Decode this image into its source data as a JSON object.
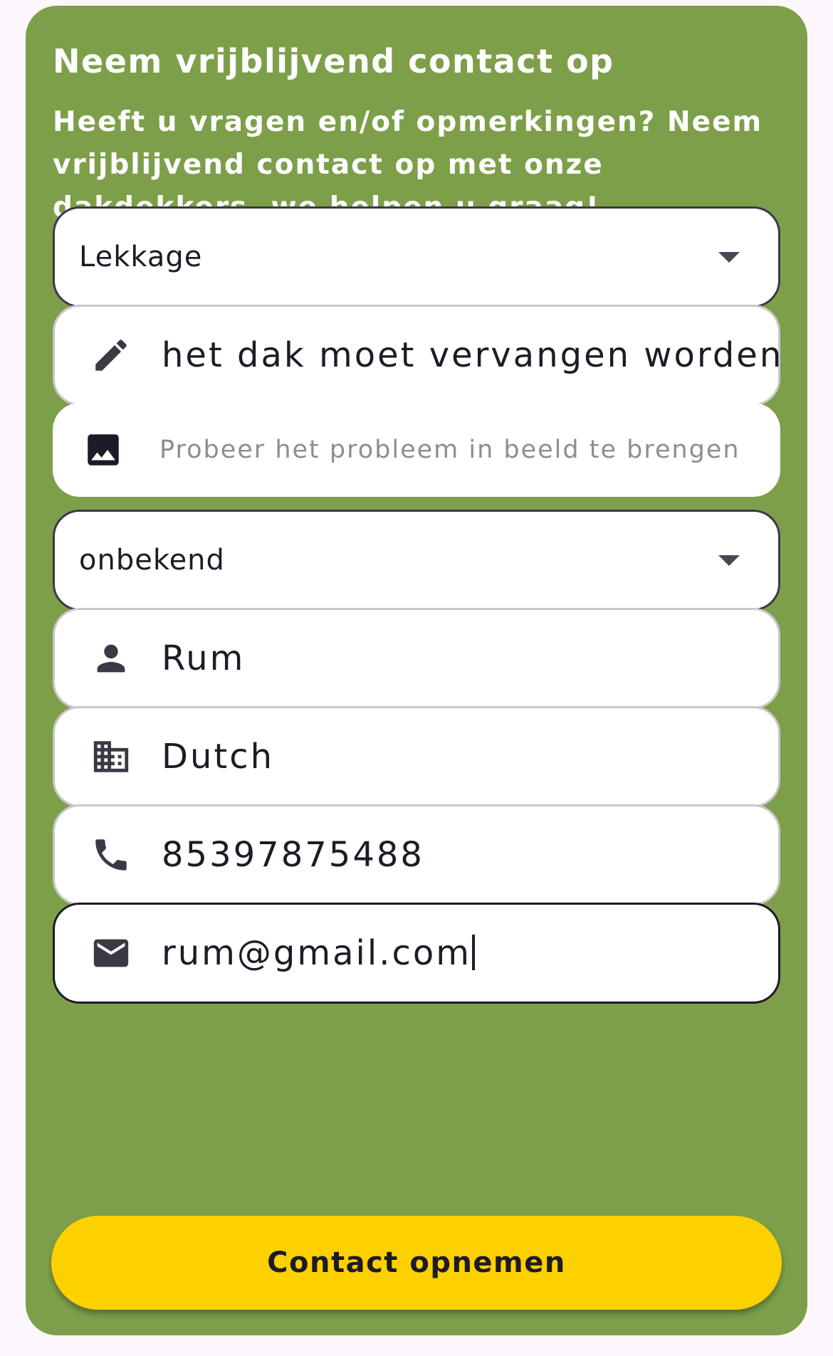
{
  "form": {
    "title": "Neem vrijblijvend contact op",
    "intro": "Heeft u vragen en/of opmerkingen? Neem vrijblijvend contact op met onze dakdekkers, we helpen u graag!",
    "category_select": {
      "value": "Lekkage",
      "icon": "chevron-down-icon"
    },
    "description_field": {
      "value": "het dak moet vervangen worden",
      "icon": "pencil-icon"
    },
    "image_field": {
      "placeholder": "Probeer het probleem in beeld te brengen",
      "icon": "image-icon"
    },
    "urgency_select": {
      "value": "onbekend",
      "icon": "chevron-down-icon"
    },
    "name_field": {
      "value": "Rum",
      "icon": "person-icon"
    },
    "company_field": {
      "value": "Dutch",
      "icon": "building-icon"
    },
    "phone_field": {
      "value": "85397875488",
      "icon": "phone-icon"
    },
    "email_field": {
      "value": "rum@gmail.com",
      "icon": "mail-icon"
    },
    "submit_label": "Contact opnemen"
  },
  "colors": {
    "page_background": "#fdf7fd",
    "card_background": "#7d9f4a",
    "field_background": "#ffffff",
    "button_background": "#fdd000",
    "text_dark": "#1d1b26",
    "icon_color": "#3b3a44",
    "placeholder_color": "#8e8c95"
  }
}
